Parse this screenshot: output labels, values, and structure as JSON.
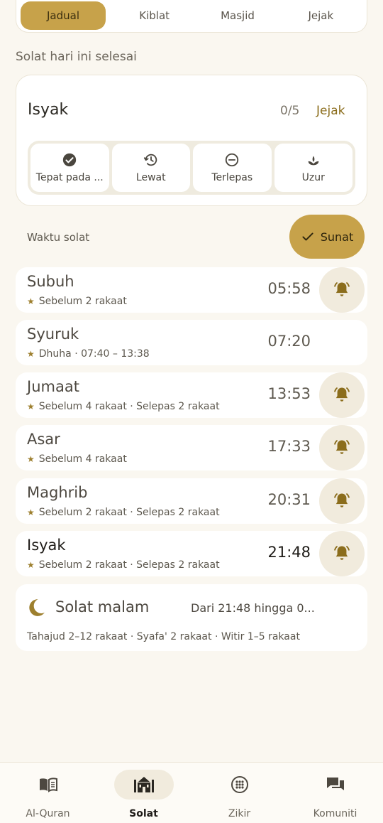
{
  "tabs": [
    "Jadual",
    "Kiblat",
    "Masjid",
    "Jejak"
  ],
  "section_title": "Solat hari ini selesai",
  "status": {
    "title": "Isyak",
    "count": "0/5",
    "link": "Jejak",
    "buttons": [
      {
        "label": "Tepat pada ...",
        "icon": "check-circle-icon"
      },
      {
        "label": "Lewat",
        "icon": "history-icon"
      },
      {
        "label": "Terlepas",
        "icon": "minus-circle-icon"
      },
      {
        "label": "Uzur",
        "icon": "leaf-icon"
      }
    ]
  },
  "times_label": "Waktu solat",
  "sunat_label": "Sunat",
  "prayers": [
    {
      "name": "Subuh",
      "sub": "Sebelum 2 rakaat",
      "time": "05:58",
      "bell": true
    },
    {
      "name": "Syuruk",
      "sub": "Dhuha · 07:40 – 13:38",
      "time": "07:20",
      "bell": false
    },
    {
      "name": "Jumaat",
      "sub": "Sebelum 4 rakaat · Selepas 2 rakaat",
      "time": "13:53",
      "bell": true
    },
    {
      "name": "Asar",
      "sub": "Sebelum 4 rakaat",
      "time": "17:33",
      "bell": true
    },
    {
      "name": "Maghrib",
      "sub": "Sebelum 2 rakaat · Selepas 2 rakaat",
      "time": "20:31",
      "bell": true
    },
    {
      "name": "Isyak",
      "sub": "Sebelum 2 rakaat · Selepas 2 rakaat",
      "time": "21:48",
      "bell": true,
      "current": true
    }
  ],
  "night": {
    "title": "Solat malam",
    "range": "Dari 21:48 hingga 0...",
    "sub": "Tahajud 2–12 rakaat · Syafa' 2 rakaat · Witir 1–5 rakaat"
  },
  "nav": [
    {
      "label": "Al-Quran",
      "icon": "book-icon"
    },
    {
      "label": "Solat",
      "icon": "mosque-icon",
      "active": true
    },
    {
      "label": "Zikir",
      "icon": "beads-icon"
    },
    {
      "label": "Komuniti",
      "icon": "chat-icon"
    }
  ],
  "colors": {
    "accent": "#c7a24a",
    "background": "#faf7f0",
    "icon": "#8b6d1c"
  }
}
